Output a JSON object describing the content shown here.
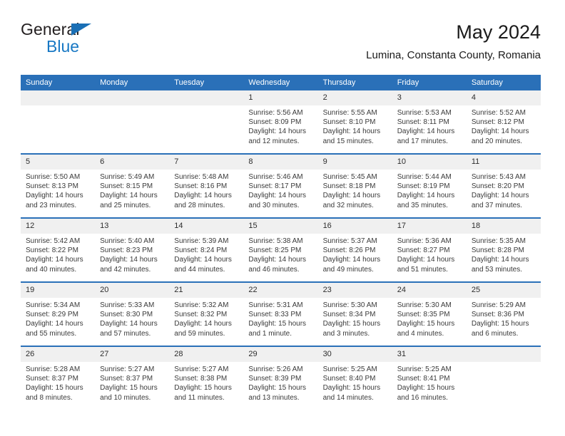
{
  "brand": {
    "name_top": "General",
    "name_bottom": "Blue",
    "triangle_color": "#1a6fb5",
    "text_color": "#1878c4"
  },
  "header": {
    "title": "May 2024",
    "subtitle": "Lumina, Constanta County, Romania"
  },
  "theme": {
    "accent": "#2a70b8",
    "header_text": "#ffffff",
    "daynum_background": "#f0f0f0"
  },
  "weekday_headers": [
    "Sunday",
    "Monday",
    "Tuesday",
    "Wednesday",
    "Thursday",
    "Friday",
    "Saturday"
  ],
  "weeks": [
    [
      {
        "day": "",
        "empty": true,
        "sunrise": "",
        "sunset": "",
        "daylight_line1": "",
        "daylight_line2": ""
      },
      {
        "day": "",
        "empty": true,
        "sunrise": "",
        "sunset": "",
        "daylight_line1": "",
        "daylight_line2": ""
      },
      {
        "day": "",
        "empty": true,
        "sunrise": "",
        "sunset": "",
        "daylight_line1": "",
        "daylight_line2": ""
      },
      {
        "day": "1",
        "empty": false,
        "sunrise": "Sunrise: 5:56 AM",
        "sunset": "Sunset: 8:09 PM",
        "daylight_line1": "Daylight: 14 hours",
        "daylight_line2": "and 12 minutes."
      },
      {
        "day": "2",
        "empty": false,
        "sunrise": "Sunrise: 5:55 AM",
        "sunset": "Sunset: 8:10 PM",
        "daylight_line1": "Daylight: 14 hours",
        "daylight_line2": "and 15 minutes."
      },
      {
        "day": "3",
        "empty": false,
        "sunrise": "Sunrise: 5:53 AM",
        "sunset": "Sunset: 8:11 PM",
        "daylight_line1": "Daylight: 14 hours",
        "daylight_line2": "and 17 minutes."
      },
      {
        "day": "4",
        "empty": false,
        "sunrise": "Sunrise: 5:52 AM",
        "sunset": "Sunset: 8:12 PM",
        "daylight_line1": "Daylight: 14 hours",
        "daylight_line2": "and 20 minutes."
      }
    ],
    [
      {
        "day": "5",
        "empty": false,
        "sunrise": "Sunrise: 5:50 AM",
        "sunset": "Sunset: 8:13 PM",
        "daylight_line1": "Daylight: 14 hours",
        "daylight_line2": "and 23 minutes."
      },
      {
        "day": "6",
        "empty": false,
        "sunrise": "Sunrise: 5:49 AM",
        "sunset": "Sunset: 8:15 PM",
        "daylight_line1": "Daylight: 14 hours",
        "daylight_line2": "and 25 minutes."
      },
      {
        "day": "7",
        "empty": false,
        "sunrise": "Sunrise: 5:48 AM",
        "sunset": "Sunset: 8:16 PM",
        "daylight_line1": "Daylight: 14 hours",
        "daylight_line2": "and 28 minutes."
      },
      {
        "day": "8",
        "empty": false,
        "sunrise": "Sunrise: 5:46 AM",
        "sunset": "Sunset: 8:17 PM",
        "daylight_line1": "Daylight: 14 hours",
        "daylight_line2": "and 30 minutes."
      },
      {
        "day": "9",
        "empty": false,
        "sunrise": "Sunrise: 5:45 AM",
        "sunset": "Sunset: 8:18 PM",
        "daylight_line1": "Daylight: 14 hours",
        "daylight_line2": "and 32 minutes."
      },
      {
        "day": "10",
        "empty": false,
        "sunrise": "Sunrise: 5:44 AM",
        "sunset": "Sunset: 8:19 PM",
        "daylight_line1": "Daylight: 14 hours",
        "daylight_line2": "and 35 minutes."
      },
      {
        "day": "11",
        "empty": false,
        "sunrise": "Sunrise: 5:43 AM",
        "sunset": "Sunset: 8:20 PM",
        "daylight_line1": "Daylight: 14 hours",
        "daylight_line2": "and 37 minutes."
      }
    ],
    [
      {
        "day": "12",
        "empty": false,
        "sunrise": "Sunrise: 5:42 AM",
        "sunset": "Sunset: 8:22 PM",
        "daylight_line1": "Daylight: 14 hours",
        "daylight_line2": "and 40 minutes."
      },
      {
        "day": "13",
        "empty": false,
        "sunrise": "Sunrise: 5:40 AM",
        "sunset": "Sunset: 8:23 PM",
        "daylight_line1": "Daylight: 14 hours",
        "daylight_line2": "and 42 minutes."
      },
      {
        "day": "14",
        "empty": false,
        "sunrise": "Sunrise: 5:39 AM",
        "sunset": "Sunset: 8:24 PM",
        "daylight_line1": "Daylight: 14 hours",
        "daylight_line2": "and 44 minutes."
      },
      {
        "day": "15",
        "empty": false,
        "sunrise": "Sunrise: 5:38 AM",
        "sunset": "Sunset: 8:25 PM",
        "daylight_line1": "Daylight: 14 hours",
        "daylight_line2": "and 46 minutes."
      },
      {
        "day": "16",
        "empty": false,
        "sunrise": "Sunrise: 5:37 AM",
        "sunset": "Sunset: 8:26 PM",
        "daylight_line1": "Daylight: 14 hours",
        "daylight_line2": "and 49 minutes."
      },
      {
        "day": "17",
        "empty": false,
        "sunrise": "Sunrise: 5:36 AM",
        "sunset": "Sunset: 8:27 PM",
        "daylight_line1": "Daylight: 14 hours",
        "daylight_line2": "and 51 minutes."
      },
      {
        "day": "18",
        "empty": false,
        "sunrise": "Sunrise: 5:35 AM",
        "sunset": "Sunset: 8:28 PM",
        "daylight_line1": "Daylight: 14 hours",
        "daylight_line2": "and 53 minutes."
      }
    ],
    [
      {
        "day": "19",
        "empty": false,
        "sunrise": "Sunrise: 5:34 AM",
        "sunset": "Sunset: 8:29 PM",
        "daylight_line1": "Daylight: 14 hours",
        "daylight_line2": "and 55 minutes."
      },
      {
        "day": "20",
        "empty": false,
        "sunrise": "Sunrise: 5:33 AM",
        "sunset": "Sunset: 8:30 PM",
        "daylight_line1": "Daylight: 14 hours",
        "daylight_line2": "and 57 minutes."
      },
      {
        "day": "21",
        "empty": false,
        "sunrise": "Sunrise: 5:32 AM",
        "sunset": "Sunset: 8:32 PM",
        "daylight_line1": "Daylight: 14 hours",
        "daylight_line2": "and 59 minutes."
      },
      {
        "day": "22",
        "empty": false,
        "sunrise": "Sunrise: 5:31 AM",
        "sunset": "Sunset: 8:33 PM",
        "daylight_line1": "Daylight: 15 hours",
        "daylight_line2": "and 1 minute."
      },
      {
        "day": "23",
        "empty": false,
        "sunrise": "Sunrise: 5:30 AM",
        "sunset": "Sunset: 8:34 PM",
        "daylight_line1": "Daylight: 15 hours",
        "daylight_line2": "and 3 minutes."
      },
      {
        "day": "24",
        "empty": false,
        "sunrise": "Sunrise: 5:30 AM",
        "sunset": "Sunset: 8:35 PM",
        "daylight_line1": "Daylight: 15 hours",
        "daylight_line2": "and 4 minutes."
      },
      {
        "day": "25",
        "empty": false,
        "sunrise": "Sunrise: 5:29 AM",
        "sunset": "Sunset: 8:36 PM",
        "daylight_line1": "Daylight: 15 hours",
        "daylight_line2": "and 6 minutes."
      }
    ],
    [
      {
        "day": "26",
        "empty": false,
        "sunrise": "Sunrise: 5:28 AM",
        "sunset": "Sunset: 8:37 PM",
        "daylight_line1": "Daylight: 15 hours",
        "daylight_line2": "and 8 minutes."
      },
      {
        "day": "27",
        "empty": false,
        "sunrise": "Sunrise: 5:27 AM",
        "sunset": "Sunset: 8:37 PM",
        "daylight_line1": "Daylight: 15 hours",
        "daylight_line2": "and 10 minutes."
      },
      {
        "day": "28",
        "empty": false,
        "sunrise": "Sunrise: 5:27 AM",
        "sunset": "Sunset: 8:38 PM",
        "daylight_line1": "Daylight: 15 hours",
        "daylight_line2": "and 11 minutes."
      },
      {
        "day": "29",
        "empty": false,
        "sunrise": "Sunrise: 5:26 AM",
        "sunset": "Sunset: 8:39 PM",
        "daylight_line1": "Daylight: 15 hours",
        "daylight_line2": "and 13 minutes."
      },
      {
        "day": "30",
        "empty": false,
        "sunrise": "Sunrise: 5:25 AM",
        "sunset": "Sunset: 8:40 PM",
        "daylight_line1": "Daylight: 15 hours",
        "daylight_line2": "and 14 minutes."
      },
      {
        "day": "31",
        "empty": false,
        "sunrise": "Sunrise: 5:25 AM",
        "sunset": "Sunset: 8:41 PM",
        "daylight_line1": "Daylight: 15 hours",
        "daylight_line2": "and 16 minutes."
      },
      {
        "day": "",
        "empty": true,
        "sunrise": "",
        "sunset": "",
        "daylight_line1": "",
        "daylight_line2": ""
      }
    ]
  ]
}
